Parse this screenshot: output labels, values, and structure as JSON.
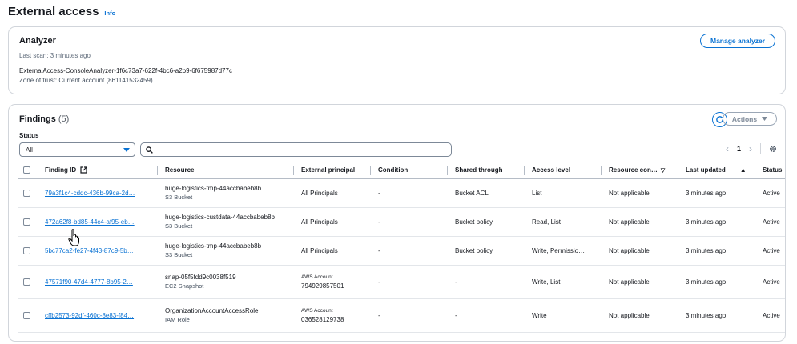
{
  "page": {
    "title": "External access",
    "info_label": "Info"
  },
  "analyzer": {
    "title": "Analyzer",
    "last_scan": "Last scan: 3 minutes ago",
    "name": "ExternalAccess-ConsoleAnalyzer-1f6c73a7-622f-4bc6-a2b9-6f675987d77c",
    "zone": "Zone of trust: Current account (861141532459)",
    "manage_label": "Manage analyzer"
  },
  "findings": {
    "title": "Findings",
    "count": "(5)",
    "actions_label": "Actions",
    "status_label": "Status",
    "status_value": "All",
    "search_placeholder": "",
    "page_number": "1",
    "columns": {
      "finding_id": "Finding ID",
      "resource": "Resource",
      "external_principal": "External principal",
      "condition": "Condition",
      "shared_through": "Shared through",
      "access_level": "Access level",
      "resource_control": "Resource con…",
      "last_updated": "Last updated",
      "status": "Status"
    },
    "rows": [
      {
        "id": "79a3f1c4-cddc-436b-99ca-2d…",
        "resource": "huge-logistics-tmp-44accbabeb8b",
        "resource_type": "S3 Bucket",
        "principal_small": "",
        "principal": "All Principals",
        "condition": "-",
        "shared_through": "Bucket ACL",
        "access_level": "List",
        "resource_control": "Not applicable",
        "last_updated": "3 minutes ago",
        "status": "Active"
      },
      {
        "id": "472a62f8-bd85-44c4-af95-eb…",
        "resource": "huge-logistics-custdata-44accbabeb8b",
        "resource_type": "S3 Bucket",
        "principal_small": "",
        "principal": "All Principals",
        "condition": "-",
        "shared_through": "Bucket policy",
        "access_level": "Read, List",
        "resource_control": "Not applicable",
        "last_updated": "3 minutes ago",
        "status": "Active"
      },
      {
        "id": "5bc77ca2-fe27-4f43-87c9-5b…",
        "resource": "huge-logistics-tmp-44accbabeb8b",
        "resource_type": "S3 Bucket",
        "principal_small": "",
        "principal": "All Principals",
        "condition": "-",
        "shared_through": "Bucket policy",
        "access_level": "Write, Permissio…",
        "resource_control": "Not applicable",
        "last_updated": "3 minutes ago",
        "status": "Active"
      },
      {
        "id": "47571f90-47d4-4777-8b95-2…",
        "resource": "snap-05f5fdd9c0038f519",
        "resource_type": "EC2 Snapshot",
        "principal_small": "AWS Account",
        "principal": "794929857501",
        "condition": "-",
        "shared_through": "-",
        "access_level": "Write, List",
        "resource_control": "Not applicable",
        "last_updated": "3 minutes ago",
        "status": "Active"
      },
      {
        "id": "cffb2573-92df-460c-8e83-f84…",
        "resource": "OrganizationAccountAccessRole",
        "resource_type": "IAM Role",
        "principal_small": "AWS Account",
        "principal": "036528129738",
        "condition": "-",
        "shared_through": "-",
        "access_level": "Write",
        "resource_control": "Not applicable",
        "last_updated": "3 minutes ago",
        "status": "Active"
      }
    ]
  },
  "colors": {
    "link": "#0972d3",
    "border": "#d1d5db",
    "text": "#16191f"
  }
}
